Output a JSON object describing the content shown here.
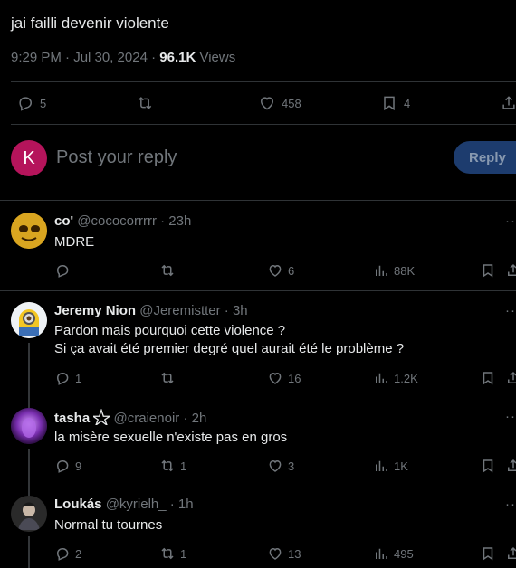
{
  "tweet": {
    "text": "jai failli devenir violente",
    "time": "9:29 PM · Jul 30, 2024 · ",
    "views": "96.1K",
    "views_label": " Views",
    "replies": "5",
    "likes": "458",
    "bookmarks": "4"
  },
  "composer": {
    "avatar_letter": "K",
    "placeholder": "Post your reply",
    "reply_label": "Reply"
  },
  "replies": [
    {
      "name": "co'",
      "handle": "@cococorrrrr · 23h",
      "text": "MDRE",
      "replies": "",
      "retweets": "",
      "likes": "6",
      "views": "88K"
    },
    {
      "name": "Jeremy Nion",
      "handle": "@Jeremistter · 3h",
      "text1": "Pardon mais pourquoi cette violence ?",
      "text2": "Si ça avait été premier degré quel aurait été le problème ?",
      "replies": "1",
      "retweets": "",
      "likes": "16",
      "views": "1.2K"
    },
    {
      "name": "tasha",
      "handle": "@craienoir · 2h",
      "text": "la misère sexuelle n'existe pas en gros",
      "replies": "9",
      "retweets": "1",
      "likes": "3",
      "views": "1K"
    },
    {
      "name": "Loukás",
      "handle": "@kyrielh_ · 1h",
      "text": "Normal tu tournes",
      "replies": "2",
      "retweets": "1",
      "likes": "13",
      "views": "495"
    }
  ],
  "colors": {
    "accent": "#1d9bf0",
    "reply_button": "#1d3c6e",
    "avatar_k": "#b5145b",
    "muted": "#71767b"
  }
}
